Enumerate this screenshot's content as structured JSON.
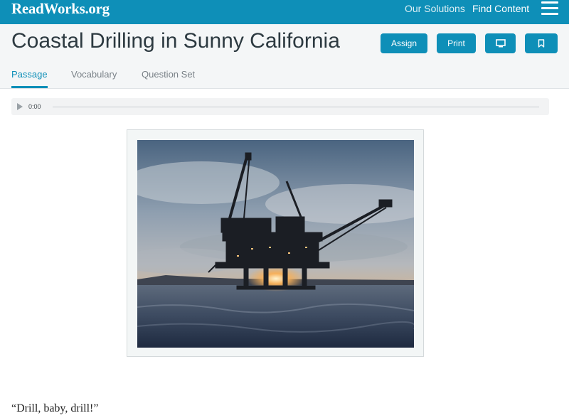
{
  "app": {
    "logo": "ReadWorks.org",
    "brand_color": "#0e8fb8"
  },
  "nav": {
    "solutions": "Our Solutions",
    "find_content": "Find Content",
    "menu_icon": "hamburger-menu-icon"
  },
  "header": {
    "title": "Coastal Drilling in Sunny California",
    "buttons": {
      "assign": "Assign",
      "print": "Print",
      "present_icon": "monitor-icon",
      "bookmark_icon": "bookmark-icon"
    }
  },
  "tabs": [
    {
      "label": "Passage",
      "active": true
    },
    {
      "label": "Vocabulary",
      "active": false
    },
    {
      "label": "Question Set",
      "active": false
    }
  ],
  "audio": {
    "play_icon": "play-icon",
    "time": "0:00",
    "progress": 0
  },
  "passage": {
    "image_subject": "offshore oil platform at sunset",
    "first_line": "“Drill, baby, drill!”"
  }
}
